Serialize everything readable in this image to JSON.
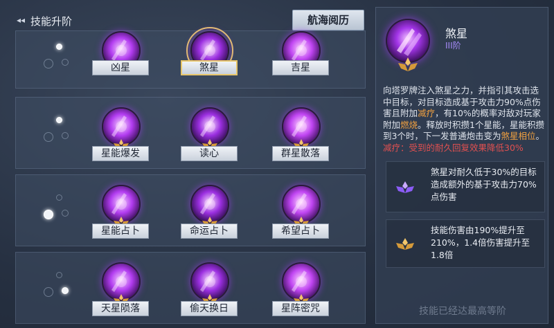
{
  "header": {
    "back_icon": "back-arrow-icon",
    "title": "技能升阶",
    "log_button": "航海阅历"
  },
  "tiers": [
    {
      "active_dot": 0,
      "skills": [
        {
          "label": "凶星",
          "icon": "fate-star-icon"
        },
        {
          "label": "煞星",
          "icon": "dark-star-icon",
          "selected": true
        },
        {
          "label": "吉星",
          "icon": "lucky-star-icon"
        }
      ]
    },
    {
      "active_dot": 0,
      "skills": [
        {
          "label": "星能爆发",
          "icon": "star-burst-icon"
        },
        {
          "label": "读心",
          "icon": "mind-read-icon"
        },
        {
          "label": "群星散落",
          "icon": "star-fall-icon"
        }
      ]
    },
    {
      "active_dot": 1,
      "skills": [
        {
          "label": "星能占卜",
          "icon": "tarot-card-icon"
        },
        {
          "label": "命运占卜",
          "icon": "fate-divination-icon"
        },
        {
          "label": "希望占卜",
          "icon": "hope-divination-icon"
        }
      ]
    },
    {
      "active_dot": 2,
      "skills": [
        {
          "label": "天星陨落",
          "icon": "meteor-icon"
        },
        {
          "label": "偷天换日",
          "icon": "moon-swap-icon"
        },
        {
          "label": "星阵密咒",
          "icon": "star-array-icon"
        }
      ]
    }
  ],
  "detail": {
    "name": "煞星",
    "rank": "III阶",
    "desc_parts": [
      {
        "t": "向塔罗牌注入煞星之力，并指引其攻击选中目标，对目标造成基于攻击力90%点伤害且附加"
      },
      {
        "t": "减疗",
        "c": "hl"
      },
      {
        "t": "，有10%的概率对敌对玩家附加"
      },
      {
        "t": "燃烧",
        "c": "hl"
      },
      {
        "t": "。释放时积攒1个星能，星能积攒到3个时，下一发普通炮击变为"
      },
      {
        "t": "煞星相位",
        "c": "hl"
      },
      {
        "t": "。"
      },
      {
        "t": "减疗：受到的耐久回复效果降低30%",
        "c": "hlred"
      }
    ],
    "upgrades": [
      {
        "text": "煞星对耐久低于30%的目标造成额外的基于攻击力70%点伤害",
        "icon": "purple-crest-icon"
      },
      {
        "text": "技能伤害由190%提升至210%，1.4倍伤害提升至1.8倍",
        "icon": "gold-crest-icon"
      }
    ],
    "maxed": "技能已经达最高等阶"
  },
  "colors": {
    "accent_gold": "#e8c66a",
    "accent_purple": "#a855f7",
    "highlight": "#f0a040"
  }
}
